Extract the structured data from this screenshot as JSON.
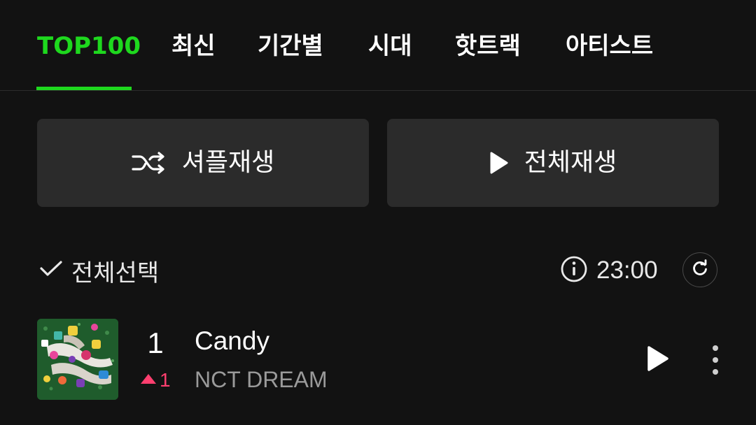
{
  "tabs": [
    {
      "label": "TOP100",
      "active": true
    },
    {
      "label": "최신",
      "active": false
    },
    {
      "label": "기간별",
      "active": false
    },
    {
      "label": "시대",
      "active": false
    },
    {
      "label": "핫트랙",
      "active": false
    },
    {
      "label": "아티스트",
      "active": false
    }
  ],
  "actions": {
    "shuffle_label": "셔플재생",
    "shuffle_icon": "shuffle-icon",
    "play_all_label": "전체재생",
    "play_all_icon": "play-icon"
  },
  "list_header": {
    "select_all_label": "전체선택",
    "select_icon": "check-icon",
    "info_icon": "info-icon",
    "update_time": "23:00",
    "refresh_icon": "refresh-icon"
  },
  "songs": [
    {
      "rank": "1",
      "rank_change": "1",
      "rank_direction": "up",
      "title": "Candy",
      "artist": "NCT DREAM",
      "play_icon": "play-icon",
      "more_icon": "more-vertical-icon"
    }
  ],
  "colors": {
    "accent": "#1ed81e",
    "background": "#121212",
    "button_bg": "#2b2b2b",
    "rank_up": "#ff3f6f",
    "secondary_text": "#9a9a9a"
  }
}
